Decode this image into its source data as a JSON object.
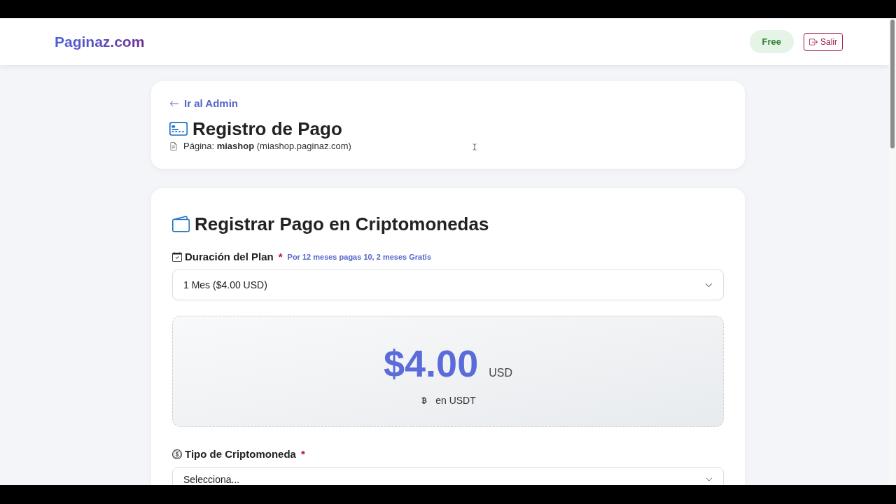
{
  "header": {
    "logo": "Paginaz.com",
    "plan_badge": "Free",
    "logout_button": "Salir"
  },
  "page_info": {
    "back_link": "Ir al Admin",
    "title": "Registro de Pago",
    "subtitle": "Página: **miashop** (miashop.paginaz.com)"
  },
  "payment_form": {
    "title": "Registrar Pago en Criptomonedas",
    "plan_duration": {
      "label": "Duración del Plan",
      "required_mark": "*",
      "hint": "Por 12 meses pagas 10, 2 meses Gratis",
      "value": "1 Mes ($4.00 USD)"
    },
    "price_summary": {
      "amount": "$4.00",
      "currency": "USD",
      "note": "en USDT"
    },
    "crypto_type": {
      "label": "Tipo de Criptomoneda",
      "required_mark": "*",
      "value": "Selecciona..."
    }
  }
}
